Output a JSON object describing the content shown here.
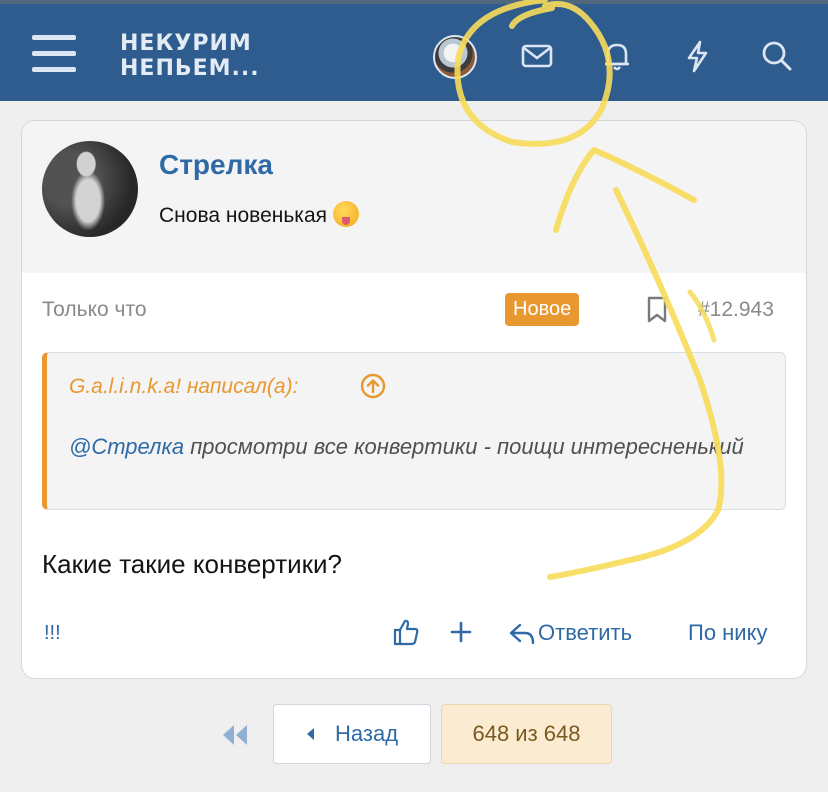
{
  "header": {
    "logo_line1": "НЕКУРИМ",
    "logo_line2": "НЕПЬЕМ...",
    "icons": [
      "menu-icon",
      "avatar",
      "envelope-icon",
      "bell-icon",
      "lightning-icon",
      "search-icon"
    ]
  },
  "post": {
    "username": "Стрелка",
    "user_title": "Снова новенькая",
    "time": "Только что",
    "badge": "Новое",
    "post_number": "#12.943",
    "quote": {
      "author_line": "G.a.l.i.n.k.a! написал(а):",
      "mention": "@Стрелка",
      "text": " просмотри все конвертики - поищи интересненький"
    },
    "body": "Какие такие конвертики?",
    "actions": {
      "report": "!!!",
      "reply": "Ответить",
      "by_nick": "По нику"
    }
  },
  "pagination": {
    "back": "Назад",
    "current": "648 из 648"
  },
  "colors": {
    "header_bg": "#2f5c8e",
    "link": "#2f6aa6",
    "accent_orange": "#e8982f",
    "marker_yellow": "#f6dc5a"
  }
}
